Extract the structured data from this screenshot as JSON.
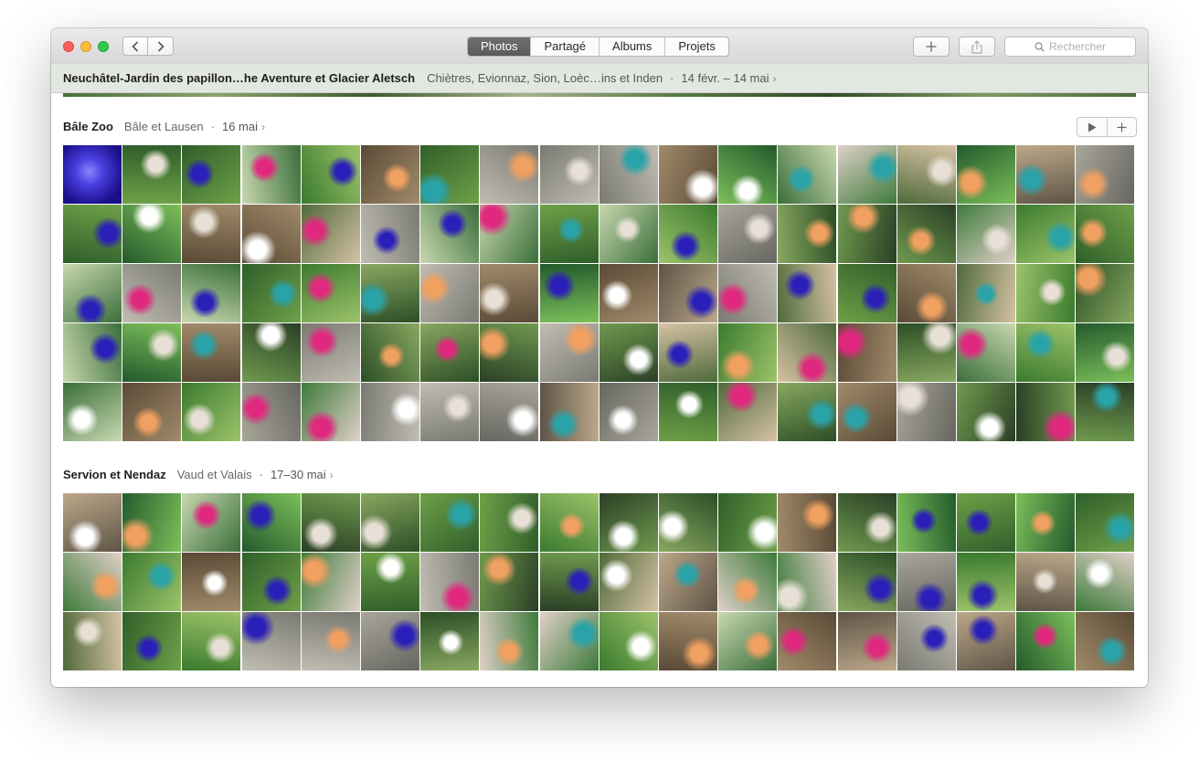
{
  "window": {
    "nav": {
      "back_icon": "chevron-left-icon",
      "forward_icon": "chevron-right-icon"
    },
    "tabs": [
      {
        "label": "Photos",
        "active": true
      },
      {
        "label": "Partagé",
        "active": false
      },
      {
        "label": "Albums",
        "active": false
      },
      {
        "label": "Projets",
        "active": false
      }
    ],
    "toolbar": {
      "add_icon": "plus-icon",
      "share_icon": "share-icon"
    },
    "search": {
      "placeholder": "Rechercher",
      "icon": "search-icon"
    }
  },
  "collection": {
    "title": "Neuchâtel-Jardin des papillon…he Aventure et Glacier Aletsch",
    "places": "Chiètres, Evionnaz, Sion, Loèc…ins et Inden",
    "separator": "·",
    "dates": "14 févr. – 14 mai",
    "chevron": "›"
  },
  "moments": [
    {
      "title": "Bâle Zoo",
      "location": "Bâle et Lausen",
      "separator": "·",
      "date": "16 mai",
      "chevron": "›",
      "actions": {
        "play_icon": "play-icon",
        "add_icon": "plus-icon"
      },
      "rows": 5,
      "cols": 18
    },
    {
      "title": "Servion et Nendaz",
      "location": "Vaud et Valais",
      "separator": "·",
      "date": "17–30 mai",
      "chevron": "›",
      "rows": 3,
      "cols": 18
    }
  ],
  "colors": {
    "active_tab": "#5f5f5f",
    "titlebar": "#e3e1e3",
    "foliage_green": "#3f8a34",
    "jellyfish_blue": "#2a1fb8",
    "shirt_pink": "#e0287e",
    "shirt_turquoise": "#2aa3a8"
  }
}
